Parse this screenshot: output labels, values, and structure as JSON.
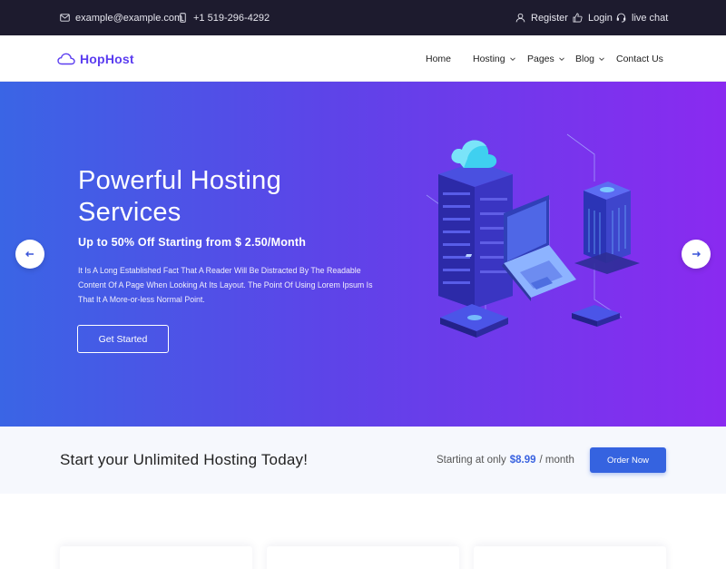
{
  "topbar": {
    "email": "example@example.com",
    "phone": "+1 519-296-4292",
    "register": "Register",
    "login": "Login",
    "live_chat": "live chat"
  },
  "nav": {
    "logo": "HopHost",
    "items": [
      {
        "label": "Home",
        "dropdown": false
      },
      {
        "label": "Hosting",
        "dropdown": true
      },
      {
        "label": "Pages",
        "dropdown": true
      },
      {
        "label": "Blog",
        "dropdown": true
      },
      {
        "label": "Contact Us",
        "dropdown": false
      }
    ]
  },
  "hero": {
    "title": "Powerful Hosting Services",
    "subtitle": "Up to 50% Off Starting from $ 2.50/Month",
    "description": "It Is A Long Established Fact That A Reader Will Be Distracted By The Readable Content Of A Page When Looking At Its Layout. The Point Of Using Lorem Ipsum Is That It A More-or-less Normal Point.",
    "button": "Get Started"
  },
  "cta": {
    "title": "Start your Unlimited Hosting Today!",
    "price_prefix": "Starting at only",
    "price": "$8.99",
    "price_suffix": "/ month",
    "button": "Order Now"
  },
  "colors": {
    "topbar_bg": "#1d1b2e",
    "brand": "#5b3df0",
    "hero_start": "#3a65e5",
    "hero_end": "#8a2af0",
    "accent_blue": "#3563e0"
  },
  "icons": {
    "email": "envelope-icon",
    "phone": "phone-icon",
    "register": "user-icon",
    "login": "thumbs-up-icon",
    "live_chat": "headset-icon",
    "logo": "cloud-icon",
    "prev": "arrow-left-icon",
    "next": "arrow-right-icon"
  }
}
